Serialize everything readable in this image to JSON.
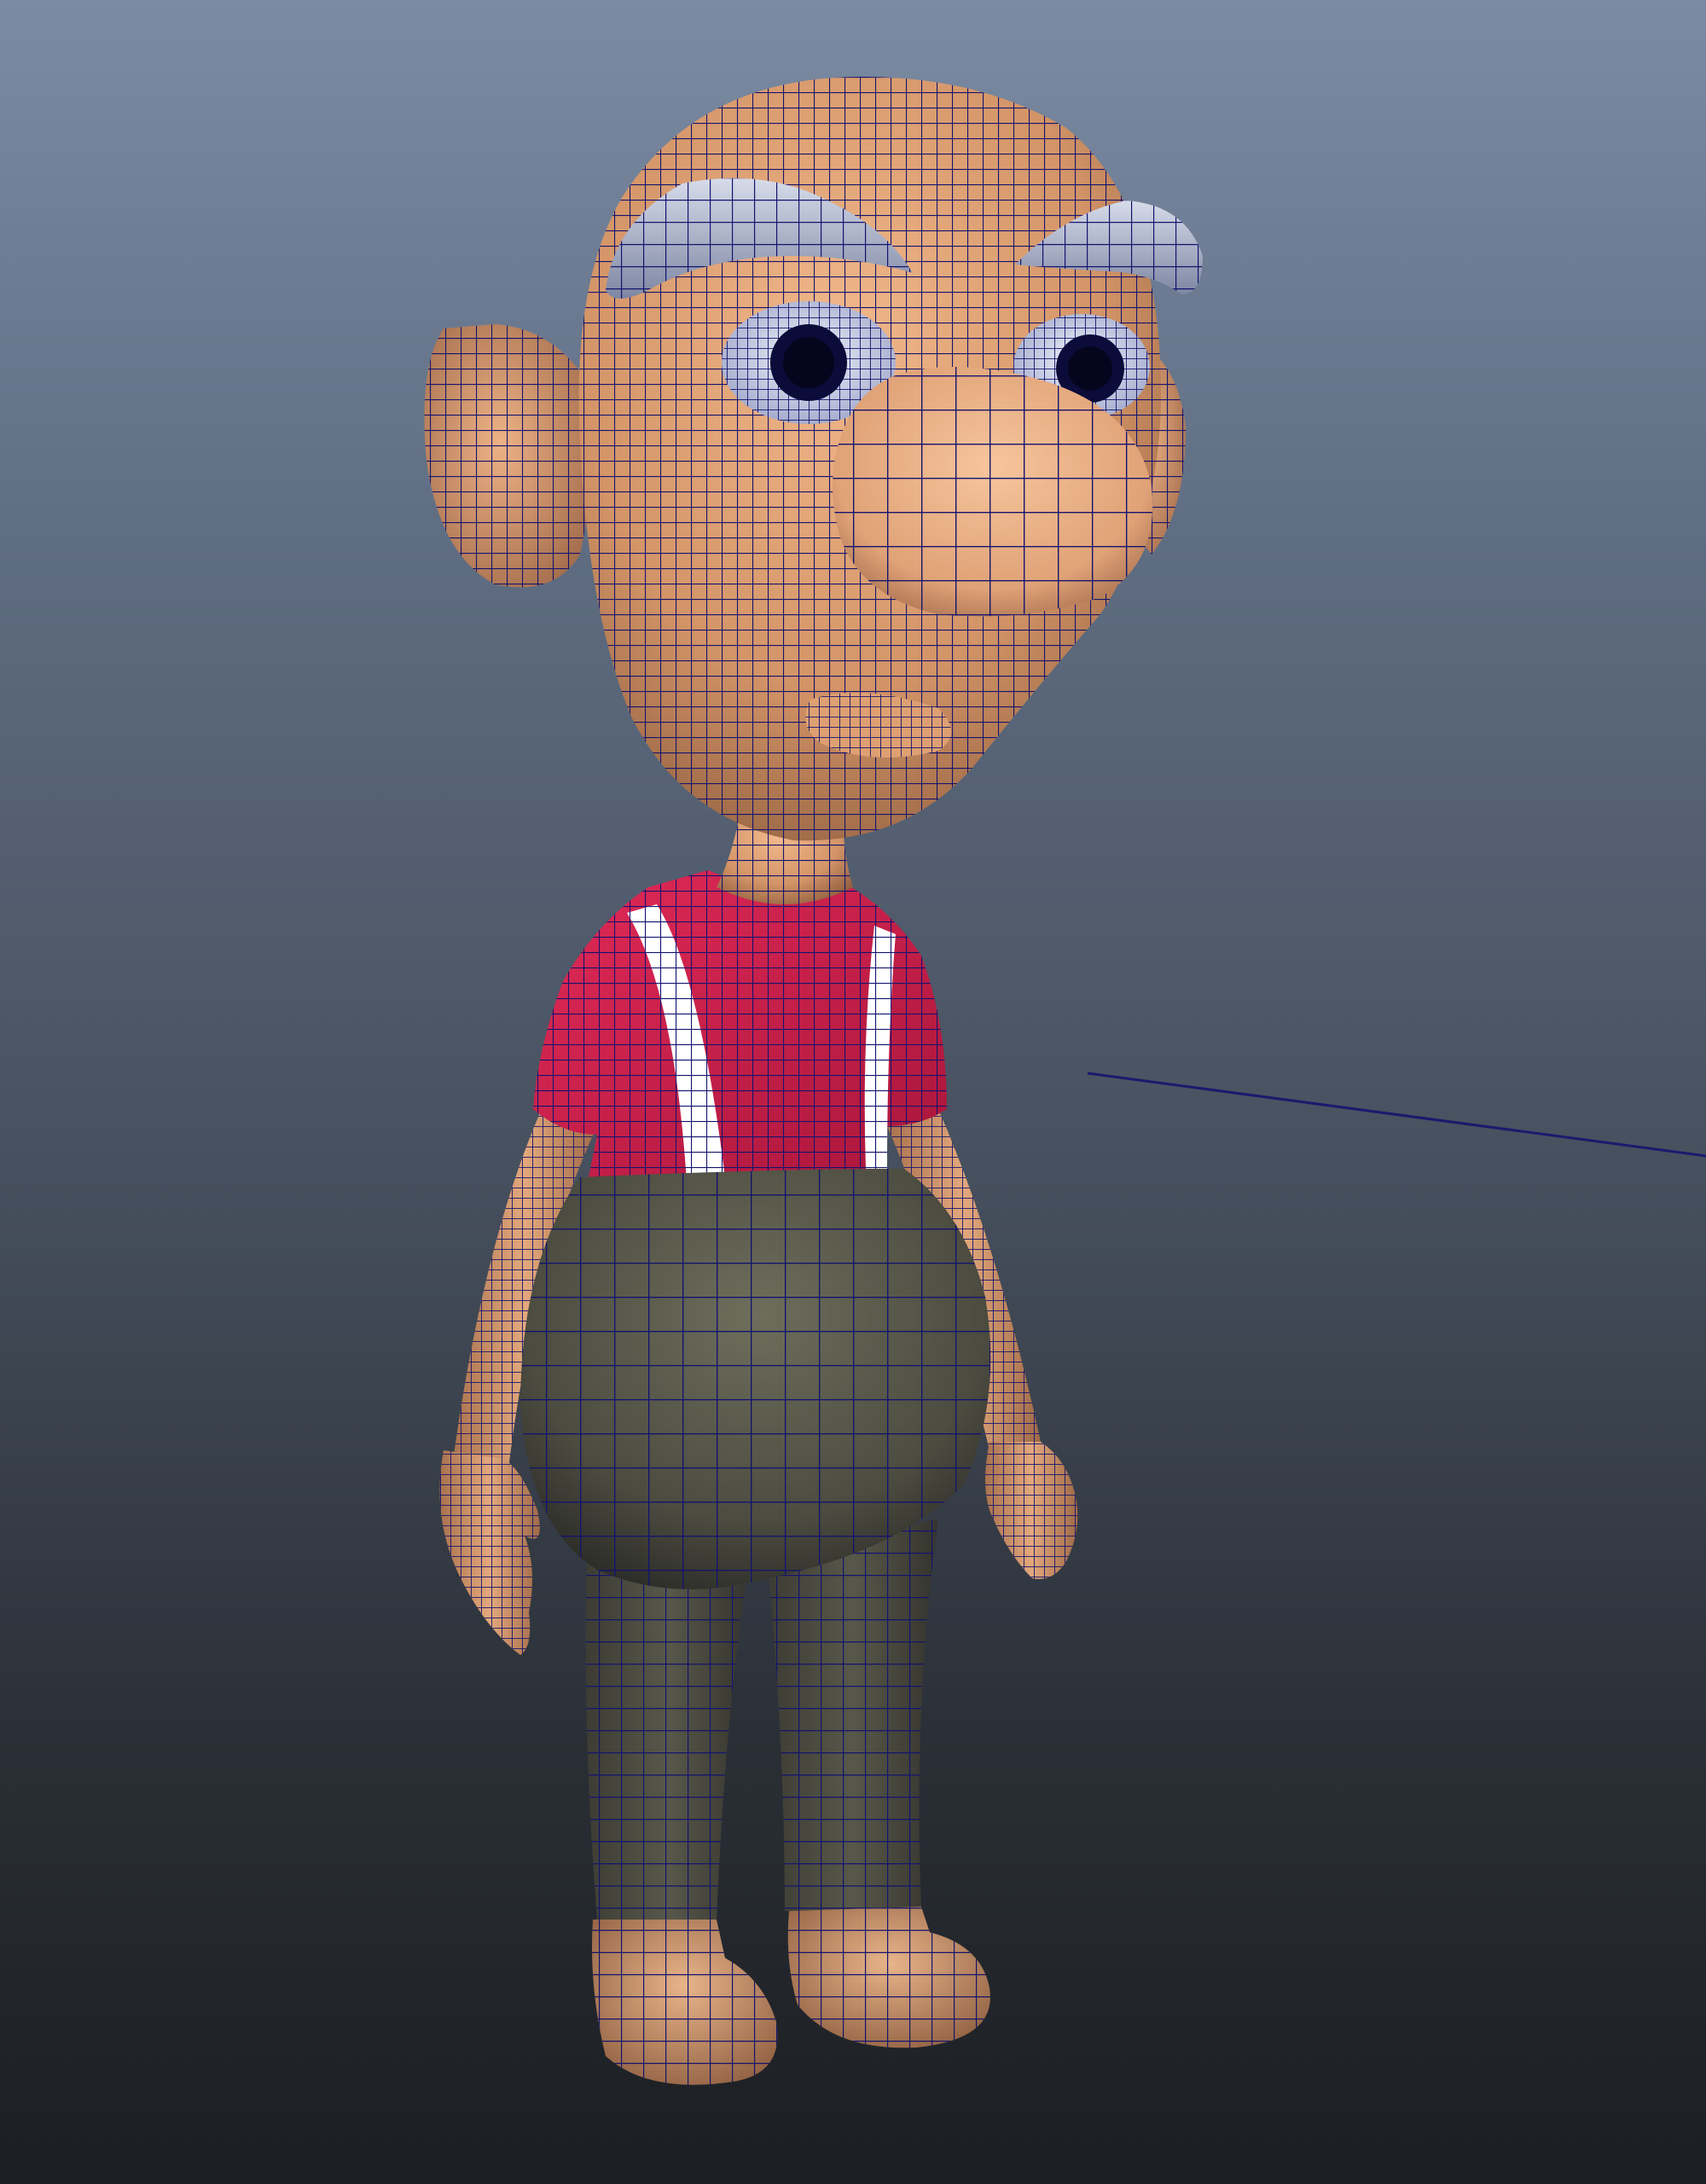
{
  "viewport": {
    "kind": "3d-modeling-viewport",
    "display_mode": "smooth-shaded-with-wireframe",
    "background_gradient": [
      "#7b8ba3",
      "#5f6d82",
      "#454e5c",
      "#2a2f36",
      "#1b1e22"
    ],
    "wire_color": "#14146e"
  },
  "model": {
    "subject": "cartoon-old-man-character",
    "materials": {
      "skin": "#e8a878",
      "skin_shadow": "#8a5a3c",
      "eyebrow": "#b8c0d8",
      "eye_white": "#dfe4f5",
      "pupil": "#0c0c3a",
      "shirt": "#d21e4c",
      "suspender": "#ffffff",
      "trousers": "#5a5a4c",
      "shoes": "#d6a278"
    }
  },
  "icons": {
    "manipulator_line": "manipulator-line-icon"
  }
}
